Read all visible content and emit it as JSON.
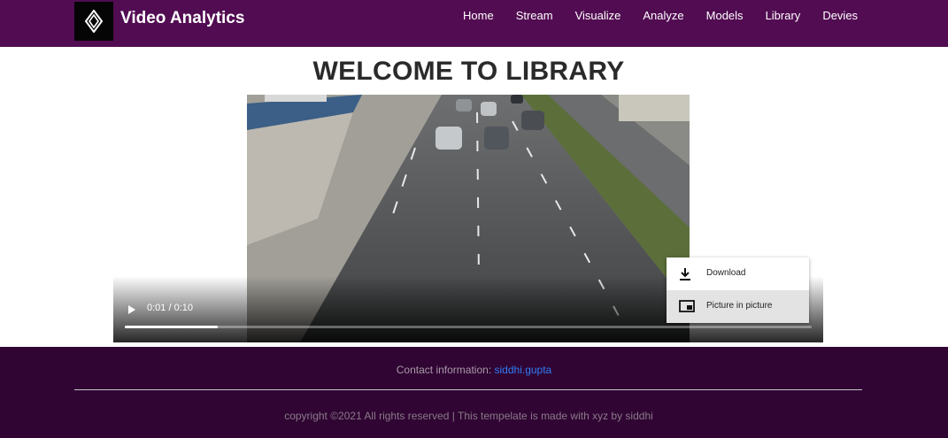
{
  "header": {
    "brand": "Video Analytics",
    "nav": [
      "Home",
      "Stream",
      "Visualize",
      "Analyze",
      "Models",
      "Library",
      "Devies"
    ]
  },
  "main": {
    "title": "WELCOME TO LIBRARY"
  },
  "video": {
    "time": "0:01 / 0:10",
    "progress_fraction": 0.135
  },
  "context_menu": {
    "items": [
      {
        "label": "Download",
        "icon": "download-icon"
      },
      {
        "label": "Picture in picture",
        "icon": "picture-in-picture-icon"
      }
    ],
    "selected": "Picture in picture"
  },
  "footer": {
    "contact_prefix": "Contact information:",
    "contact_link": "siddhi.gupta",
    "copyright": "copyright ©2021 All rights reserved | This tempelate is made with xyz by siddhi"
  },
  "colors": {
    "navbar": "#520c52",
    "footer": "#300533",
    "link": "#2f7cf4"
  }
}
